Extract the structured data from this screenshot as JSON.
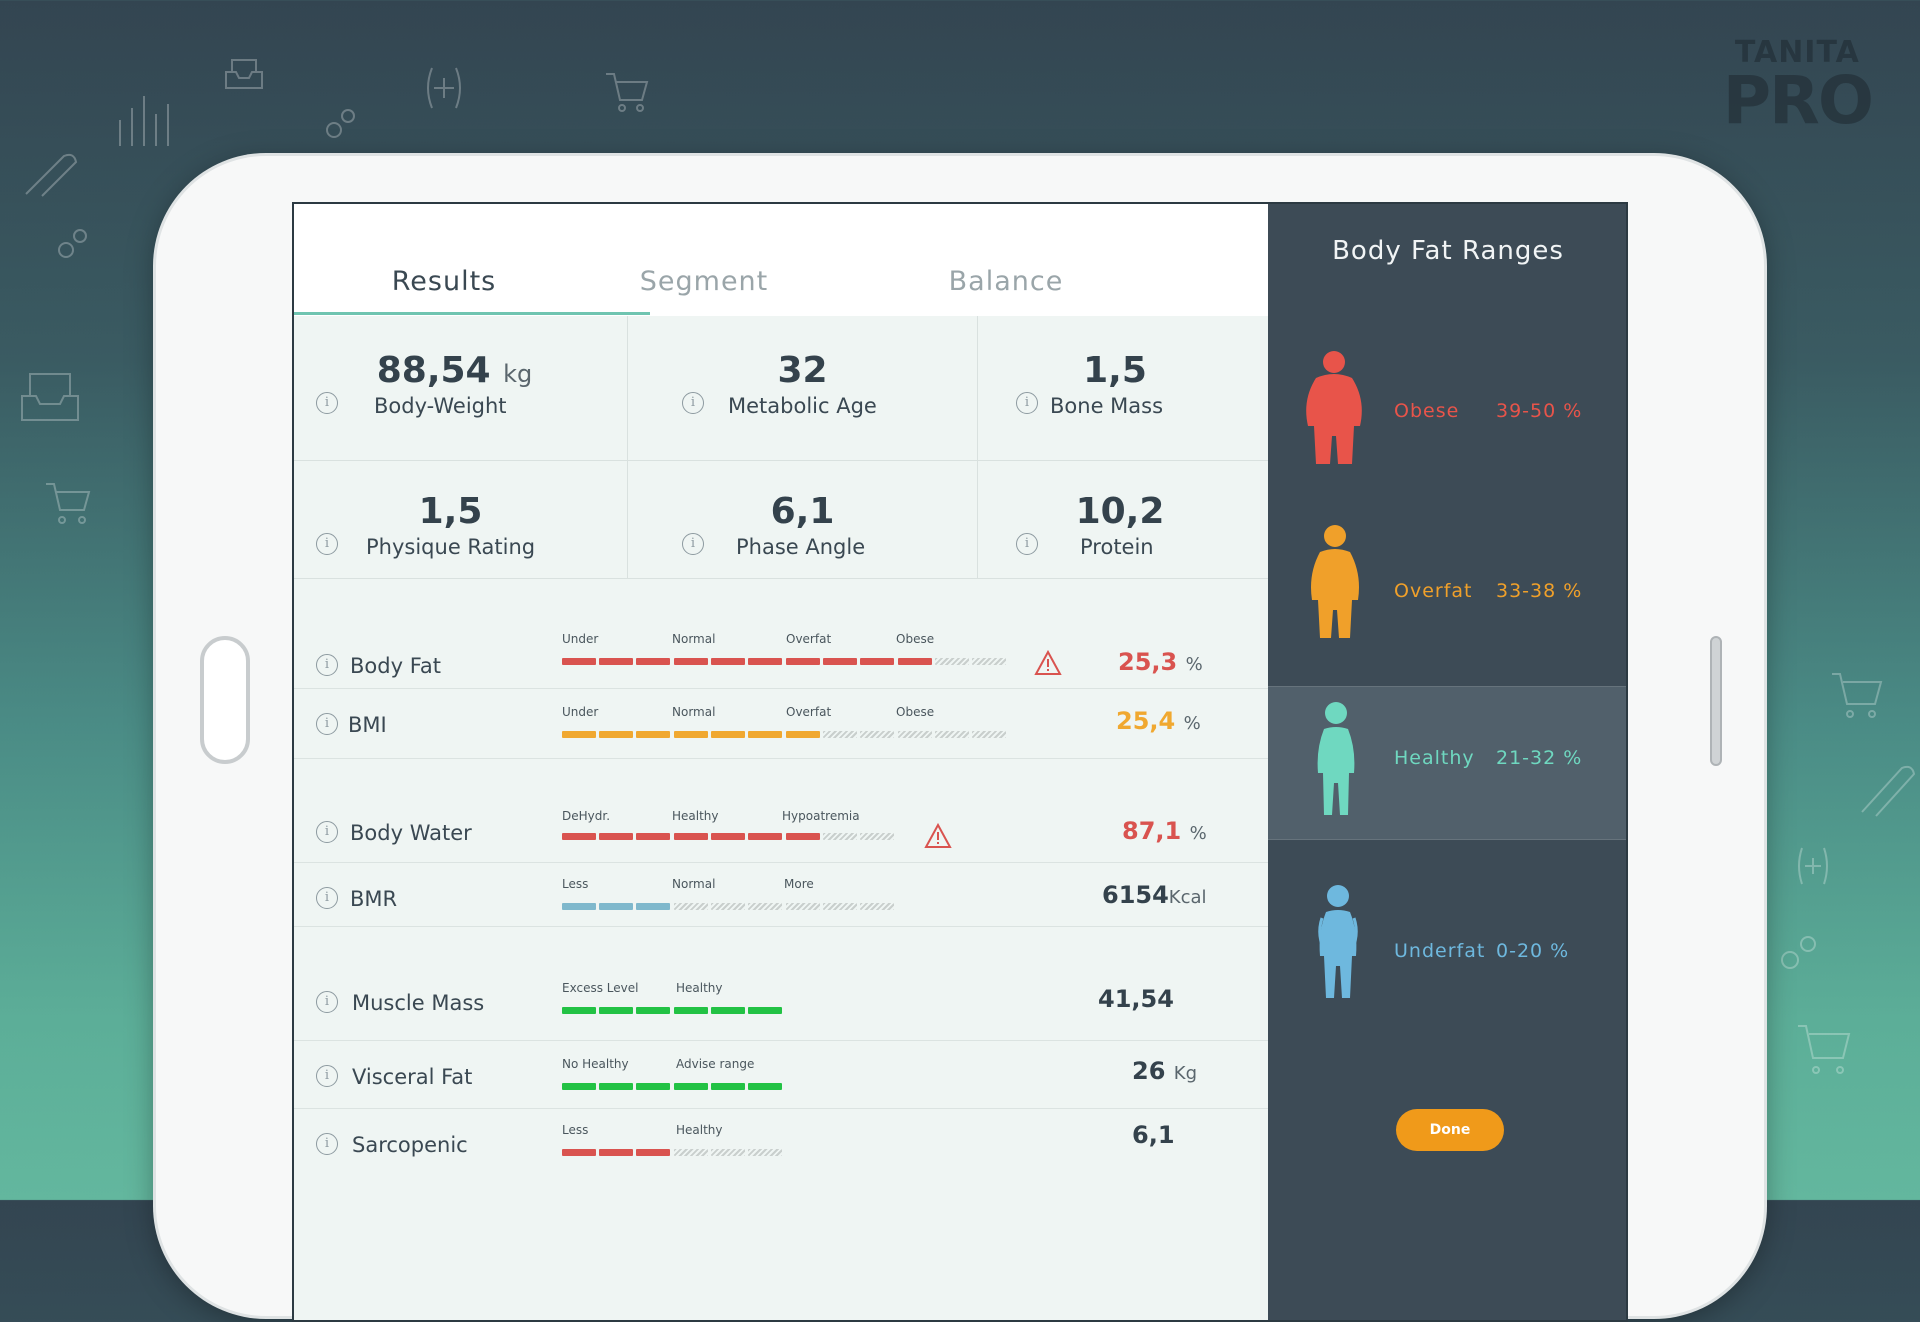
{
  "brand": {
    "line1": "TANITA",
    "line2": "PRO"
  },
  "tabs": [
    {
      "label": "Results",
      "active": true
    },
    {
      "label": "Segment",
      "active": false
    },
    {
      "label": "Balance",
      "active": false
    }
  ],
  "metrics": [
    {
      "value": "88,54",
      "unit": "kg",
      "label": "Body-Weight"
    },
    {
      "value": "32",
      "unit": "",
      "label": "Metabolic Age"
    },
    {
      "value": "1,5",
      "unit": "",
      "label": "Bone Mass"
    },
    {
      "value": "1,5",
      "unit": "",
      "label": "Physique Rating"
    },
    {
      "value": "6,1",
      "unit": "",
      "label": "Phase Angle"
    },
    {
      "value": "10,2",
      "unit": "",
      "label": "Protein"
    }
  ],
  "rows": [
    {
      "name": "Body Fat",
      "scale": [
        "Under",
        "Normal",
        "Overfat",
        "Obese"
      ],
      "filled": 10,
      "total": 12,
      "color": "#d9534f",
      "value": "25,3",
      "unit": "%",
      "value_color": "#d9534f",
      "warning": true
    },
    {
      "name": "BMI",
      "scale": [
        "Under",
        "Normal",
        "Overfat",
        "Obese"
      ],
      "filled": 7,
      "total": 12,
      "color": "#f0a830",
      "value": "25,4",
      "unit": "%",
      "value_color": "#f0a830",
      "warning": false
    },
    {
      "name": "Body Water",
      "scale": [
        "DeHydr.",
        "Healthy",
        "Hypoatremia"
      ],
      "filled": 7,
      "total": 9,
      "color": "#d9534f",
      "value": "87,1",
      "unit": "%",
      "value_color": "#d9534f",
      "warning": true
    },
    {
      "name": "BMR",
      "scale": [
        "Less",
        "Normal",
        "More"
      ],
      "filled": 3,
      "total": 9,
      "color": "#7fb8cc",
      "value": "6154",
      "unit": "Kcal",
      "value_color": "#34424c",
      "warning": false
    },
    {
      "name": "Muscle Mass",
      "scale": [
        "Excess Level",
        "Healthy"
      ],
      "filled": 6,
      "total": 6,
      "color": "#22c244",
      "value": "41,54",
      "unit": "",
      "value_color": "#34424c",
      "warning": false
    },
    {
      "name": "Visceral Fat",
      "scale": [
        "No Healthy",
        "Advise range"
      ],
      "filled": 6,
      "total": 6,
      "color": "#22c244",
      "value": "26",
      "unit": "Kg",
      "value_color": "#34424c",
      "warning": false
    },
    {
      "name": "Sarcopenic",
      "scale": [
        "Less",
        "Healthy"
      ],
      "filled": 3,
      "total": 6,
      "color": "#d9534f",
      "value": "6,1",
      "unit": "",
      "value_color": "#34424c",
      "warning": false
    }
  ],
  "panel": {
    "title": "Body Fat Ranges",
    "ranges": [
      {
        "label": "Obese",
        "percent": "39-50 %",
        "color": "#e8544a",
        "selected": false
      },
      {
        "label": "Overfat",
        "percent": "33-38 %",
        "color": "#f0a02a",
        "selected": false
      },
      {
        "label": "Healthy",
        "percent": "21-32 %",
        "color": "#6fd8c0",
        "selected": true
      },
      {
        "label": "Underfat",
        "percent": "0-20 %",
        "color": "#6eb8de",
        "selected": false
      }
    ],
    "done_label": "Done"
  }
}
